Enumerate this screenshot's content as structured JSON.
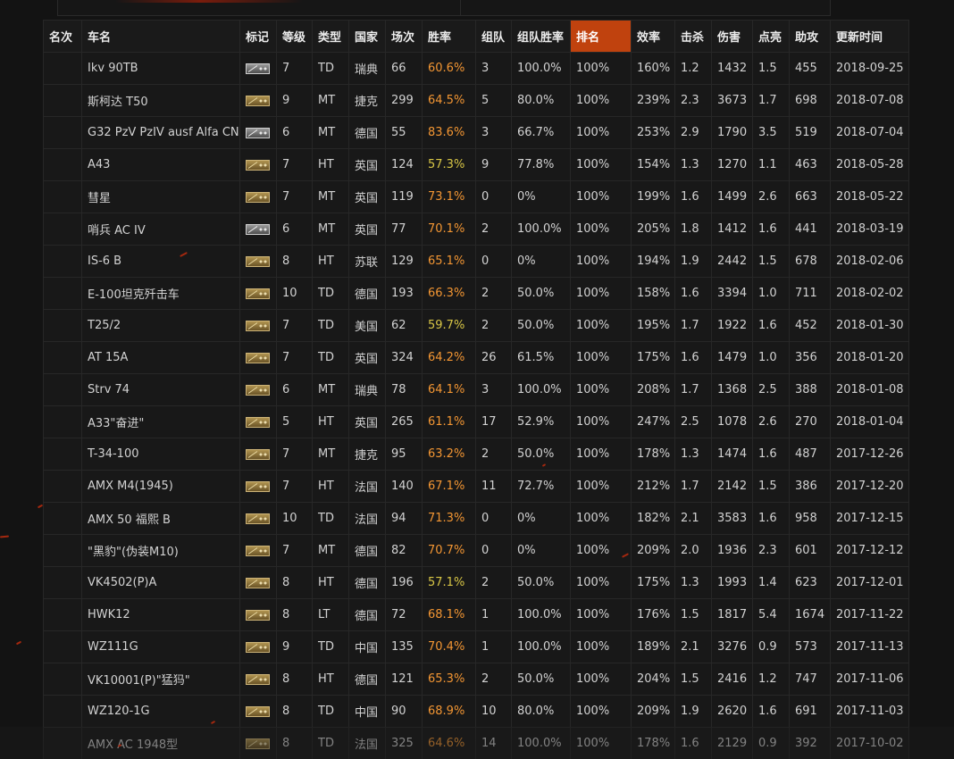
{
  "colors": {
    "page_background": "#131313",
    "text": "#d2d2d2",
    "winrate_high": "#f39633",
    "winrate_mid": "#d8c646",
    "ranking_value": "#ff7a1f",
    "ranking_header_background": "#c0420e"
  },
  "table": {
    "columns": [
      "名次",
      "车名",
      "标记",
      "等级",
      "类型",
      "国家",
      "场次",
      "胜率",
      "组队",
      "组队胜率",
      "排名",
      "效率",
      "击杀",
      "伤害",
      "点亮",
      "助攻",
      "更新时间"
    ],
    "active_column": "排名",
    "rows": [
      {
        "name": "Ikv 90TB",
        "mark": "silver",
        "tier": 7,
        "type": "TD",
        "nation": "瑞典",
        "battles": 66,
        "winrate": "60.6%",
        "winrate_level": "high",
        "platoon": 3,
        "platoon_winrate": "100.0%",
        "ranking": "100%",
        "efficiency": "160%",
        "kills": "1.2",
        "damage": 1432,
        "spotted": "1.5",
        "assist": 455,
        "updated": "2018-09-25"
      },
      {
        "name": "斯柯达 T50",
        "mark": "gold",
        "tier": 9,
        "type": "MT",
        "nation": "捷克",
        "battles": 299,
        "winrate": "64.5%",
        "winrate_level": "high",
        "platoon": 5,
        "platoon_winrate": "80.0%",
        "ranking": "100%",
        "efficiency": "239%",
        "kills": "2.3",
        "damage": 3673,
        "spotted": "1.7",
        "assist": 698,
        "updated": "2018-07-08"
      },
      {
        "name": "G32 PzV PzIV ausf Alfa CN",
        "mark": "silver",
        "tier": 6,
        "type": "MT",
        "nation": "德国",
        "battles": 55,
        "winrate": "83.6%",
        "winrate_level": "high",
        "platoon": 3,
        "platoon_winrate": "66.7%",
        "ranking": "100%",
        "efficiency": "253%",
        "kills": "2.9",
        "damage": 1790,
        "spotted": "3.5",
        "assist": 519,
        "updated": "2018-07-04"
      },
      {
        "name": "A43",
        "mark": "gold",
        "tier": 7,
        "type": "HT",
        "nation": "英国",
        "battles": 124,
        "winrate": "57.3%",
        "winrate_level": "mid",
        "platoon": 9,
        "platoon_winrate": "77.8%",
        "ranking": "100%",
        "efficiency": "154%",
        "kills": "1.3",
        "damage": 1270,
        "spotted": "1.1",
        "assist": 463,
        "updated": "2018-05-28"
      },
      {
        "name": "彗星",
        "mark": "gold",
        "tier": 7,
        "type": "MT",
        "nation": "英国",
        "battles": 119,
        "winrate": "73.1%",
        "winrate_level": "high",
        "platoon": 0,
        "platoon_winrate": "0%",
        "ranking": "100%",
        "efficiency": "199%",
        "kills": "1.6",
        "damage": 1499,
        "spotted": "2.6",
        "assist": 663,
        "updated": "2018-05-22"
      },
      {
        "name": "哨兵 AC IV",
        "mark": "silver",
        "tier": 6,
        "type": "MT",
        "nation": "英国",
        "battles": 77,
        "winrate": "70.1%",
        "winrate_level": "high",
        "platoon": 2,
        "platoon_winrate": "100.0%",
        "ranking": "100%",
        "efficiency": "205%",
        "kills": "1.8",
        "damage": 1412,
        "spotted": "1.6",
        "assist": 441,
        "updated": "2018-03-19"
      },
      {
        "name": "IS-6 B",
        "mark": "gold",
        "tier": 8,
        "type": "HT",
        "nation": "苏联",
        "battles": 129,
        "winrate": "65.1%",
        "winrate_level": "high",
        "platoon": 0,
        "platoon_winrate": "0%",
        "ranking": "100%",
        "efficiency": "194%",
        "kills": "1.9",
        "damage": 2442,
        "spotted": "1.5",
        "assist": 678,
        "updated": "2018-02-06"
      },
      {
        "name": "E-100坦克歼击车",
        "mark": "gold",
        "tier": 10,
        "type": "TD",
        "nation": "德国",
        "battles": 193,
        "winrate": "66.3%",
        "winrate_level": "high",
        "platoon": 2,
        "platoon_winrate": "50.0%",
        "ranking": "100%",
        "efficiency": "158%",
        "kills": "1.6",
        "damage": 3394,
        "spotted": "1.0",
        "assist": 711,
        "updated": "2018-02-02"
      },
      {
        "name": "T25/2",
        "mark": "gold",
        "tier": 7,
        "type": "TD",
        "nation": "美国",
        "battles": 62,
        "winrate": "59.7%",
        "winrate_level": "mid",
        "platoon": 2,
        "platoon_winrate": "50.0%",
        "ranking": "100%",
        "efficiency": "195%",
        "kills": "1.7",
        "damage": 1922,
        "spotted": "1.6",
        "assist": 452,
        "updated": "2018-01-30"
      },
      {
        "name": "AT 15A",
        "mark": "gold",
        "tier": 7,
        "type": "TD",
        "nation": "英国",
        "battles": 324,
        "winrate": "64.2%",
        "winrate_level": "high",
        "platoon": 26,
        "platoon_winrate": "61.5%",
        "ranking": "100%",
        "efficiency": "175%",
        "kills": "1.6",
        "damage": 1479,
        "spotted": "1.0",
        "assist": 356,
        "updated": "2018-01-20"
      },
      {
        "name": "Strv 74",
        "mark": "gold",
        "tier": 6,
        "type": "MT",
        "nation": "瑞典",
        "battles": 78,
        "winrate": "64.1%",
        "winrate_level": "high",
        "platoon": 3,
        "platoon_winrate": "100.0%",
        "ranking": "100%",
        "efficiency": "208%",
        "kills": "1.7",
        "damage": 1368,
        "spotted": "2.5",
        "assist": 388,
        "updated": "2018-01-08"
      },
      {
        "name": "A33\"奋进\"",
        "mark": "gold",
        "tier": 5,
        "type": "HT",
        "nation": "英国",
        "battles": 265,
        "winrate": "61.1%",
        "winrate_level": "high",
        "platoon": 17,
        "platoon_winrate": "52.9%",
        "ranking": "100%",
        "efficiency": "247%",
        "kills": "2.5",
        "damage": 1078,
        "spotted": "2.6",
        "assist": 270,
        "updated": "2018-01-04"
      },
      {
        "name": "T-34-100",
        "mark": "gold",
        "tier": 7,
        "type": "MT",
        "nation": "捷克",
        "battles": 95,
        "winrate": "63.2%",
        "winrate_level": "high",
        "platoon": 2,
        "platoon_winrate": "50.0%",
        "ranking": "100%",
        "efficiency": "178%",
        "kills": "1.3",
        "damage": 1474,
        "spotted": "1.6",
        "assist": 487,
        "updated": "2017-12-26"
      },
      {
        "name": "AMX M4(1945)",
        "mark": "gold",
        "tier": 7,
        "type": "HT",
        "nation": "法国",
        "battles": 140,
        "winrate": "67.1%",
        "winrate_level": "high",
        "platoon": 11,
        "platoon_winrate": "72.7%",
        "ranking": "100%",
        "efficiency": "212%",
        "kills": "1.7",
        "damage": 2142,
        "spotted": "1.5",
        "assist": 386,
        "updated": "2017-12-20"
      },
      {
        "name": "AMX 50 福熙 B",
        "mark": "gold",
        "tier": 10,
        "type": "TD",
        "nation": "法国",
        "battles": 94,
        "winrate": "71.3%",
        "winrate_level": "high",
        "platoon": 0,
        "platoon_winrate": "0%",
        "ranking": "100%",
        "efficiency": "182%",
        "kills": "2.1",
        "damage": 3583,
        "spotted": "1.6",
        "assist": 958,
        "updated": "2017-12-15"
      },
      {
        "name": "\"黑豹\"(伪装M10)",
        "mark": "gold",
        "tier": 7,
        "type": "MT",
        "nation": "德国",
        "battles": 82,
        "winrate": "70.7%",
        "winrate_level": "high",
        "platoon": 0,
        "platoon_winrate": "0%",
        "ranking": "100%",
        "efficiency": "209%",
        "kills": "2.0",
        "damage": 1936,
        "spotted": "2.3",
        "assist": 601,
        "updated": "2017-12-12"
      },
      {
        "name": "VK4502(P)A",
        "mark": "gold",
        "tier": 8,
        "type": "HT",
        "nation": "德国",
        "battles": 196,
        "winrate": "57.1%",
        "winrate_level": "mid",
        "platoon": 2,
        "platoon_winrate": "50.0%",
        "ranking": "100%",
        "efficiency": "175%",
        "kills": "1.3",
        "damage": 1993,
        "spotted": "1.4",
        "assist": 623,
        "updated": "2017-12-01"
      },
      {
        "name": "HWK12",
        "mark": "gold",
        "tier": 8,
        "type": "LT",
        "nation": "德国",
        "battles": 72,
        "winrate": "68.1%",
        "winrate_level": "high",
        "platoon": 1,
        "platoon_winrate": "100.0%",
        "ranking": "100%",
        "efficiency": "176%",
        "kills": "1.5",
        "damage": 1817,
        "spotted": "5.4",
        "assist": 1674,
        "updated": "2017-11-22"
      },
      {
        "name": "WZ111G",
        "mark": "gold",
        "tier": 9,
        "type": "TD",
        "nation": "中国",
        "battles": 135,
        "winrate": "70.4%",
        "winrate_level": "high",
        "platoon": 1,
        "platoon_winrate": "100.0%",
        "ranking": "100%",
        "efficiency": "189%",
        "kills": "2.1",
        "damage": 3276,
        "spotted": "0.9",
        "assist": 573,
        "updated": "2017-11-13"
      },
      {
        "name": "VK10001(P)\"猛犸\"",
        "mark": "gold",
        "tier": 8,
        "type": "HT",
        "nation": "德国",
        "battles": 121,
        "winrate": "65.3%",
        "winrate_level": "high",
        "platoon": 2,
        "platoon_winrate": "50.0%",
        "ranking": "100%",
        "efficiency": "204%",
        "kills": "1.5",
        "damage": 2416,
        "spotted": "1.2",
        "assist": 747,
        "updated": "2017-11-06"
      },
      {
        "name": "WZ120-1G",
        "mark": "gold",
        "tier": 8,
        "type": "TD",
        "nation": "中国",
        "battles": 90,
        "winrate": "68.9%",
        "winrate_level": "high",
        "platoon": 10,
        "platoon_winrate": "80.0%",
        "ranking": "100%",
        "efficiency": "209%",
        "kills": "1.9",
        "damage": 2620,
        "spotted": "1.6",
        "assist": 691,
        "updated": "2017-11-03"
      },
      {
        "name": "AMX AC 1948型",
        "mark": "gold",
        "tier": 8,
        "type": "TD",
        "nation": "法国",
        "battles": 325,
        "winrate": "64.6%",
        "winrate_level": "high",
        "platoon": 14,
        "platoon_winrate": "100.0%",
        "ranking": "100%",
        "efficiency": "178%",
        "kills": "1.6",
        "damage": 2129,
        "spotted": "0.9",
        "assist": 392,
        "updated": "2017-10-02"
      }
    ]
  }
}
